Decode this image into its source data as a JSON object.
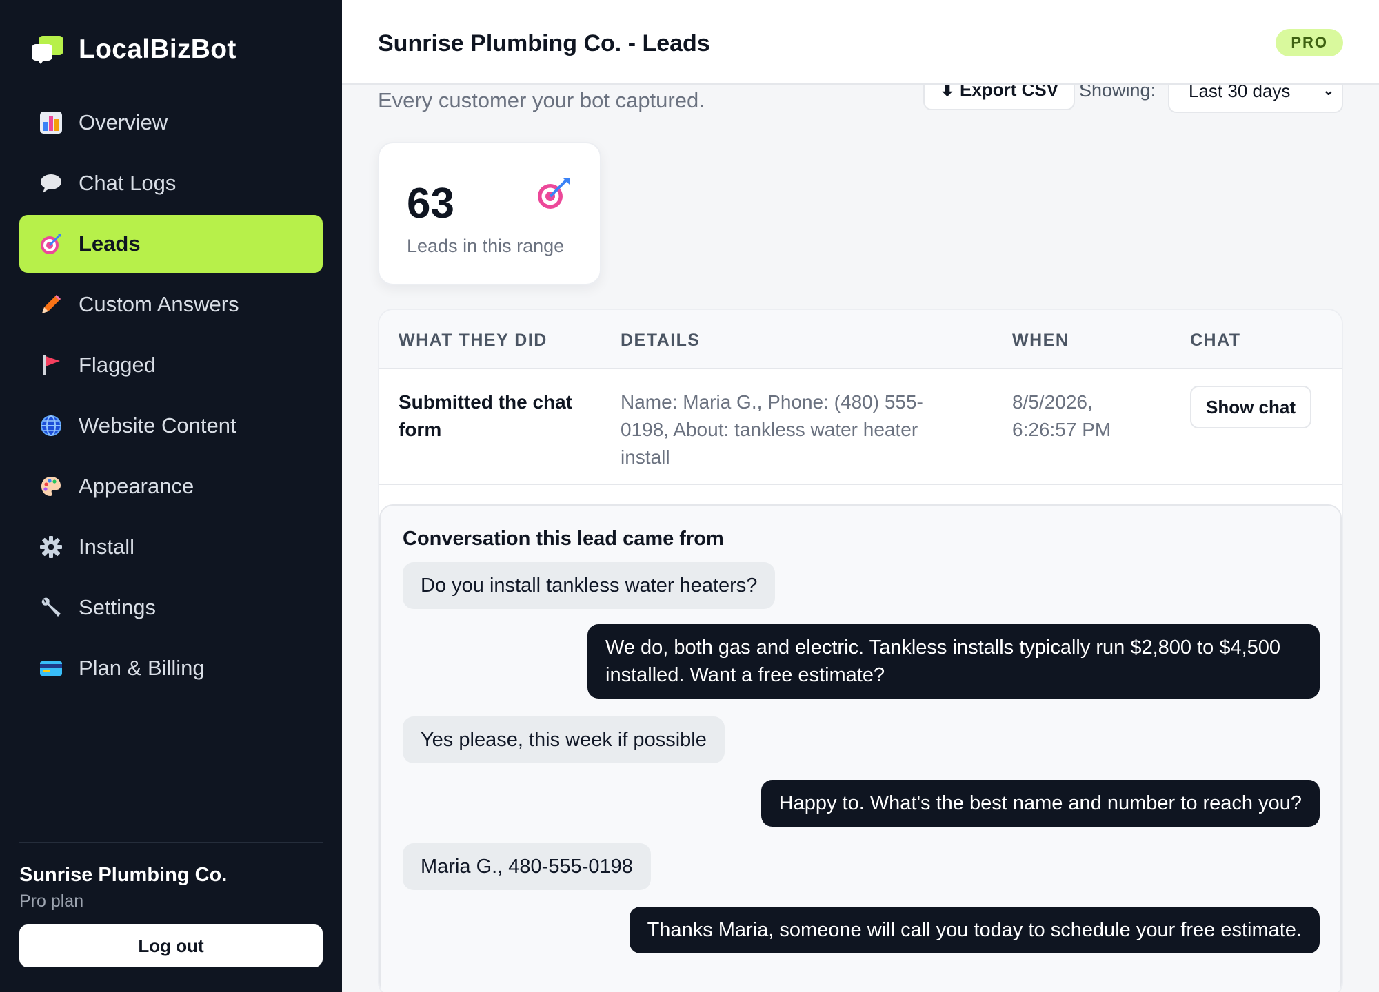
{
  "brand": {
    "name": "LocalBizBot"
  },
  "sidebar": {
    "items": [
      {
        "label": "Overview",
        "icon": "bar-chart-icon",
        "active": false
      },
      {
        "label": "Chat Logs",
        "icon": "speech-bubble-icon",
        "active": false
      },
      {
        "label": "Leads",
        "icon": "target-icon",
        "active": true
      },
      {
        "label": "Custom Answers",
        "icon": "pencil-icon",
        "active": false
      },
      {
        "label": "Flagged",
        "icon": "flag-icon",
        "active": false
      },
      {
        "label": "Website Content",
        "icon": "globe-icon",
        "active": false
      },
      {
        "label": "Appearance",
        "icon": "palette-icon",
        "active": false
      },
      {
        "label": "Install",
        "icon": "gear-icon",
        "active": false
      },
      {
        "label": "Settings",
        "icon": "wrench-icon",
        "active": false
      },
      {
        "label": "Plan & Billing",
        "icon": "credit-card-icon",
        "active": false
      }
    ],
    "business_name": "Sunrise Plumbing Co.",
    "plan": "Pro plan",
    "logout_label": "Log out"
  },
  "header": {
    "title": "Sunrise Plumbing Co. - Leads",
    "badge": "PRO"
  },
  "main": {
    "subtitle": "Every customer your bot captured.",
    "export_label": "⬇ Export CSV",
    "showing_label": "Showing:",
    "range_value": "Last 30 days"
  },
  "stat": {
    "value": "63",
    "label": "Leads in this range"
  },
  "table": {
    "columns": [
      "WHAT THEY DID",
      "DETAILS",
      "WHEN",
      "CHAT"
    ],
    "rows": [
      {
        "did": "Submitted the chat form",
        "details": "Name: Maria G., Phone: (480) 555-0198, About: tankless water heater install",
        "when": "8/5/2026, 6:26:57 PM",
        "action": "Show chat"
      }
    ]
  },
  "conversation": {
    "title": "Conversation this lead came from",
    "messages": [
      {
        "from": "user",
        "text": "Do you install tankless water heaters?"
      },
      {
        "from": "bot",
        "text": "We do, both gas and electric. Tankless installs typically run $2,800 to $4,500 installed. Want a free estimate?"
      },
      {
        "from": "user",
        "text": "Yes please, this week if possible"
      },
      {
        "from": "bot",
        "text": "Happy to. What's the best name and number to reach you?"
      },
      {
        "from": "user",
        "text": "Maria G., 480-555-0198"
      },
      {
        "from": "bot",
        "text": "Thanks Maria, someone will call you today to schedule your free estimate."
      }
    ]
  },
  "colors": {
    "sidebar_bg": "#0f1521",
    "accent": "#b7f04a",
    "bot_bubble": "#0f1521",
    "user_bubble": "#e9ecef"
  }
}
